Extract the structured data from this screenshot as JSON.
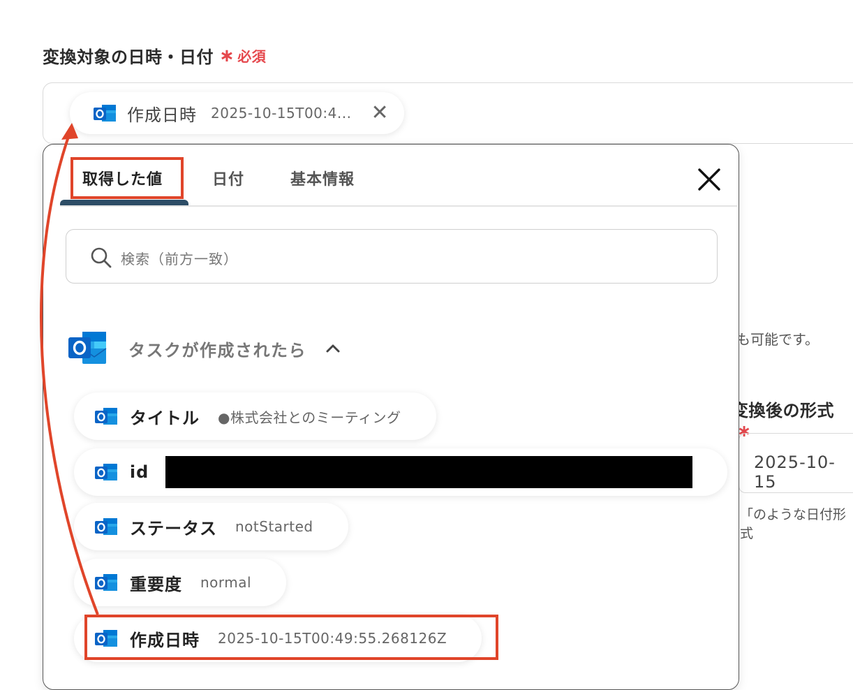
{
  "field": {
    "label": "変換対象の日時・日付",
    "required_star": "∗",
    "required_text": "必須",
    "selected_chip": {
      "name": "作成日時",
      "value": "2025-10-15T00:4...",
      "remove": "✕"
    }
  },
  "background": {
    "note_fragment": "も可能です。",
    "format_label": "変換後の形式",
    "format_star": "∗",
    "format_value": "2025-10-15",
    "format_hint": "「のような日付形式"
  },
  "panel": {
    "tabs": [
      {
        "label": "取得した値",
        "active": true
      },
      {
        "label": "日付",
        "active": false
      },
      {
        "label": "基本情報",
        "active": false
      }
    ],
    "search_placeholder": "検索（前方一致）",
    "group": {
      "title": "タスクが作成されたら",
      "expanded": true,
      "items": [
        {
          "name": "タイトル",
          "value": "●株式会社とのミーティング"
        },
        {
          "name": "id",
          "value": ""
        },
        {
          "name": "ステータス",
          "value": "notStarted"
        },
        {
          "name": "重要度",
          "value": "normal"
        },
        {
          "name": "作成日時",
          "value": "2025-10-15T00:49:55.268126Z"
        }
      ]
    }
  },
  "colors": {
    "accent_red": "#e0452a",
    "required_red": "#e5484d",
    "tab_underline": "#2d4d66",
    "outlook_blue": "#0a64c6"
  },
  "icons": [
    "outlook-icon",
    "close-icon",
    "search-icon",
    "chevron-up-icon"
  ]
}
